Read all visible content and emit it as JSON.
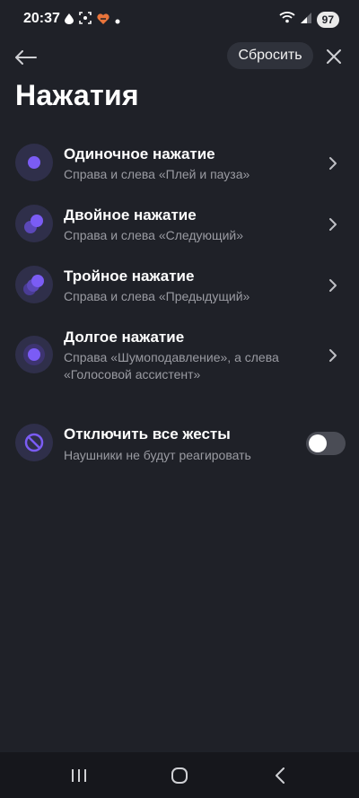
{
  "status": {
    "time": "20:37",
    "battery": "97",
    "left_icons": [
      "notification-drop-icon",
      "screenshot-icon",
      "heart-app-icon",
      "dot-icon"
    ],
    "right_icons": [
      "wifi-icon",
      "signal-icon"
    ]
  },
  "toolbar": {
    "reset_label": "Сбросить"
  },
  "page": {
    "title": "Нажатия"
  },
  "items": [
    {
      "title": "Одиночное нажатие",
      "subtitle": "Справа и слева «Плей и пауза»",
      "icon": "single-tap-icon"
    },
    {
      "title": "Двойное нажатие",
      "subtitle": "Справа и слева «Следующий»",
      "icon": "double-tap-icon"
    },
    {
      "title": "Тройное нажатие",
      "subtitle": "Справа и слева «Предыдущий»",
      "icon": "triple-tap-icon"
    },
    {
      "title": "Долгое нажатие",
      "subtitle": "Справа «Шумоподавление», а слева «Голосовой ассистент»",
      "icon": "long-press-icon"
    }
  ],
  "disable": {
    "title": "Отключить все жесты",
    "subtitle": "Наушники не будут реагировать",
    "enabled": false,
    "icon": "disable-icon"
  },
  "colors": {
    "background": "#1f2128",
    "accent": "#7b5cf5",
    "icon_bg": "#2f2f4a",
    "subtext": "#9a9ba2"
  }
}
